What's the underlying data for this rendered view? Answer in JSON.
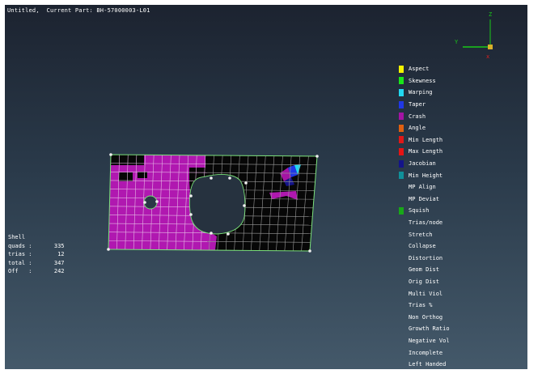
{
  "header": {
    "title": "Untitled,  Current Part: BH-57000003-L01"
  },
  "triad": {
    "z_label": "Z",
    "y_label": "Y"
  },
  "legend": {
    "items": [
      {
        "label": "Aspect",
        "color": "#f4f400"
      },
      {
        "label": "Skewness",
        "color": "#19e619"
      },
      {
        "label": "Warping",
        "color": "#22d8f0"
      },
      {
        "label": "Taper",
        "color": "#2038e6"
      },
      {
        "label": "Crash",
        "color": "#a414a4"
      },
      {
        "label": "Angle",
        "color": "#e06010"
      },
      {
        "label": "Min Length",
        "color": "#e01818"
      },
      {
        "label": "Max Length",
        "color": "#e61414"
      },
      {
        "label": "Jacobian",
        "color": "#14148a"
      },
      {
        "label": "Min Height",
        "color": "#10909a"
      },
      {
        "label": "MP Align",
        "color": ""
      },
      {
        "label": "MP Deviat",
        "color": ""
      },
      {
        "label": "Squish",
        "color": "#18a818"
      },
      {
        "label": "Trias/node",
        "color": ""
      },
      {
        "label": "Stretch",
        "color": ""
      },
      {
        "label": "Collapse",
        "color": ""
      },
      {
        "label": "Distortion",
        "color": ""
      },
      {
        "label": "Geom Dist",
        "color": ""
      },
      {
        "label": "Orig Dist",
        "color": ""
      },
      {
        "label": "Multi Viol",
        "color": ""
      },
      {
        "label": "Trias %",
        "color": ""
      },
      {
        "label": "Non Orthog",
        "color": ""
      },
      {
        "label": "Growth Ratio",
        "color": ""
      },
      {
        "label": "Negative Vol",
        "color": ""
      },
      {
        "label": "Incomplete",
        "color": ""
      },
      {
        "label": "Left Handed",
        "color": ""
      }
    ]
  },
  "stats": {
    "title": "Shell",
    "rows": [
      {
        "label": "quads :",
        "value": "335"
      },
      {
        "label": "trias :",
        "value": "12"
      },
      {
        "label": "total :",
        "value": "347"
      },
      {
        "label": "Off   :",
        "value": "242"
      }
    ]
  },
  "colors": {
    "mesh_fill": "#b018b0",
    "mesh_dark": "#070707",
    "grid_on_dark": "#9a9a9a",
    "grid_on_magenta": "#e4b8e4",
    "edge": "#7ae07a",
    "node": "#f0f0f0"
  }
}
